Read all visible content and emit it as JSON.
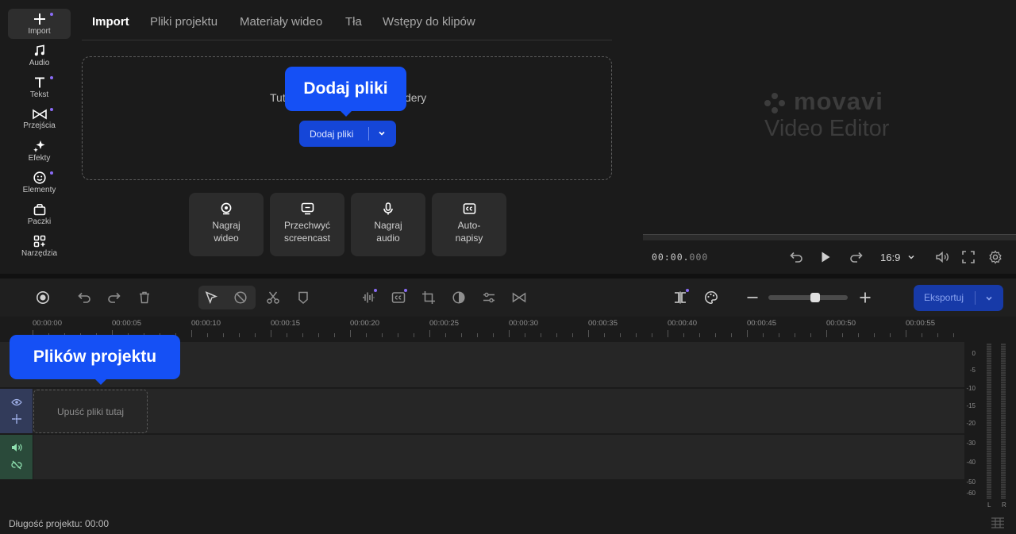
{
  "leftnav": {
    "items": [
      {
        "label": "Import",
        "icon": "plus-icon",
        "active": true,
        "dot": true
      },
      {
        "label": "Audio",
        "icon": "music-note-icon",
        "dot": false
      },
      {
        "label": "Tekst",
        "icon": "text-icon",
        "dot": true
      },
      {
        "label": "Przejścia",
        "icon": "transitions-icon",
        "dot": true
      },
      {
        "label": "Efekty",
        "icon": "sparkle-icon",
        "dot": false
      },
      {
        "label": "Elementy",
        "icon": "smiley-icon",
        "dot": true
      },
      {
        "label": "Paczki",
        "icon": "package-icon",
        "dot": false
      },
      {
        "label": "Narzędzia",
        "icon": "tools-grid-icon",
        "dot": false
      }
    ]
  },
  "media": {
    "tabs": [
      "Import",
      "Pliki projektu",
      "Materiały wideo",
      "Tła",
      "Wstępy do klipów"
    ],
    "dropzone_text_left": "Tut",
    "dropzone_text_right": "dery",
    "add_files_label": "Dodaj pliki",
    "capture_buttons": [
      {
        "label": "Nagraj\nwideo",
        "icon": "webcam-icon"
      },
      {
        "label": "Przechwyć\nscreencast",
        "icon": "monitor-icon"
      },
      {
        "label": "Nagraj\naudio",
        "icon": "microphone-icon"
      },
      {
        "label": "Auto-\nnapisy",
        "icon": "closed-captions-icon"
      }
    ]
  },
  "tooltips": {
    "add_files": "Dodaj pliki",
    "project_files": "Plików projektu"
  },
  "player": {
    "logo_word": "movavi",
    "logo_sub": "Video Editor",
    "timecode_main": "00:00.",
    "timecode_ms": "000",
    "aspect": "16:9"
  },
  "toolbar": {
    "export_label": "Eksportuj",
    "zoom_level": 0.6
  },
  "ruler": {
    "ticks": [
      "00:00:00",
      "00:00:05",
      "00:00:10",
      "00:00:15",
      "00:00:20",
      "00:00:25",
      "00:00:30",
      "00:00:35",
      "00:00:40",
      "00:00:45",
      "00:00:50",
      "00:00:55"
    ]
  },
  "tracks": {
    "drop_label": "Upuść pliki tutaj"
  },
  "meter": {
    "labels": [
      "0",
      "-5",
      "-10",
      "-15",
      "-20",
      "-30",
      "-40",
      "-50",
      "-60"
    ],
    "left": "L",
    "right": "R"
  },
  "status": {
    "project_length": "Długość projektu: 00:00"
  },
  "colors": {
    "accent": "#1550f5",
    "button_blue": "#1546d8",
    "dot_purple": "#8a6cf7",
    "video_track_head": "#323b5a",
    "audio_track_head": "#2a4a3a"
  }
}
